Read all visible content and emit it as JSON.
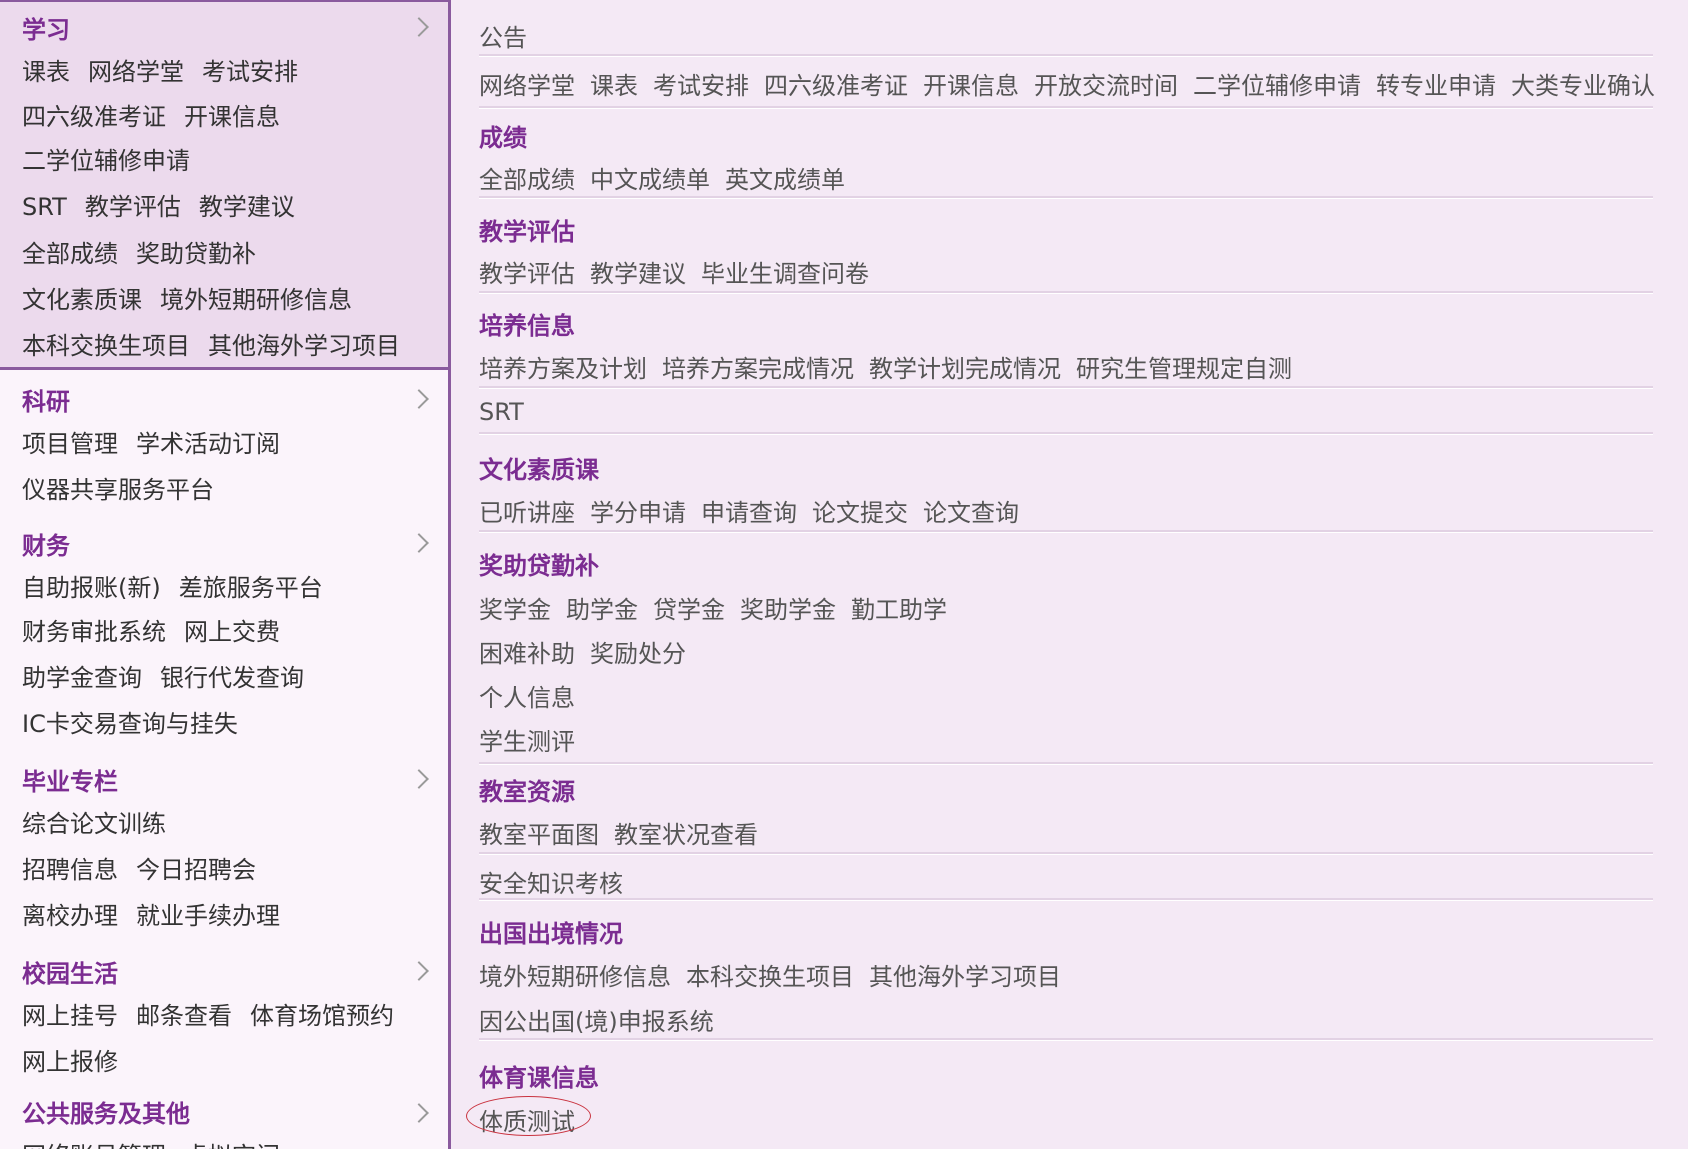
{
  "sidebar": {
    "sections": [
      {
        "title": "学习",
        "rows": [
          [
            "课表",
            "网络学堂",
            "考试安排"
          ],
          [
            "四六级准考证",
            "开课信息"
          ],
          [
            "二学位辅修申请"
          ],
          [
            "SRT",
            "教学评估",
            "教学建议"
          ],
          [
            "全部成绩",
            "奖助贷勤补"
          ],
          [
            "文化素质课",
            "境外短期研修信息"
          ],
          [
            "本科交换生项目",
            "其他海外学习项目"
          ]
        ]
      },
      {
        "title": "科研",
        "rows": [
          [
            "项目管理",
            "学术活动订阅"
          ],
          [
            "仪器共享服务平台"
          ]
        ]
      },
      {
        "title": "财务",
        "rows": [
          [
            "自助报账(新)",
            "差旅服务平台"
          ],
          [
            "财务审批系统",
            "网上交费"
          ],
          [
            "助学金查询",
            "银行代发查询"
          ],
          [
            "IC卡交易查询与挂失"
          ]
        ]
      },
      {
        "title": "毕业专栏",
        "rows": [
          [
            "综合论文训练"
          ],
          [
            "招聘信息",
            "今日招聘会"
          ],
          [
            "离校办理",
            "就业手续办理"
          ]
        ]
      },
      {
        "title": "校园生活",
        "rows": [
          [
            "网上挂号",
            "邮条查看",
            "体育场馆预约"
          ],
          [
            "网上报修"
          ]
        ]
      },
      {
        "title": "公共服务及其他",
        "rows": [
          [
            "网络账号管理",
            "虚拟空间"
          ]
        ]
      }
    ]
  },
  "content": {
    "groups": [
      {
        "title": "",
        "rows": [
          [
            "公告"
          ],
          [
            "网络学堂",
            "课表",
            "考试安排",
            "四六级准考证",
            "开课信息",
            "开放交流时间",
            "二学位辅修申请",
            "转专业申请",
            "大类专业确认"
          ]
        ]
      },
      {
        "title": "成绩",
        "rows": [
          [
            "全部成绩",
            "中文成绩单",
            "英文成绩单"
          ]
        ]
      },
      {
        "title": "教学评估",
        "rows": [
          [
            "教学评估",
            "教学建议",
            "毕业生调查问卷"
          ]
        ]
      },
      {
        "title": "培养信息",
        "rows": [
          [
            "培养方案及计划",
            "培养方案完成情况",
            "教学计划完成情况",
            "研究生管理规定自测"
          ]
        ]
      },
      {
        "title": "",
        "rows": [
          [
            "SRT"
          ]
        ]
      },
      {
        "title": "文化素质课",
        "rows": [
          [
            "已听讲座",
            "学分申请",
            "申请查询",
            "论文提交",
            "论文查询"
          ]
        ]
      },
      {
        "title": "奖助贷勤补",
        "rows": [
          [
            "奖学金",
            "助学金",
            "贷学金",
            "奖助学金",
            "勤工助学"
          ],
          [
            "困难补助",
            "奖励处分"
          ],
          [
            "个人信息"
          ],
          [
            "学生测评"
          ]
        ]
      },
      {
        "title": "教室资源",
        "rows": [
          [
            "教室平面图",
            "教室状况查看"
          ]
        ]
      },
      {
        "title": "",
        "rows": [
          [
            "安全知识考核"
          ]
        ]
      },
      {
        "title": "出国出境情况",
        "rows": [
          [
            "境外短期研修信息",
            "本科交换生项目",
            "其他海外学习项目"
          ],
          [
            "因公出国(境)申报系统"
          ]
        ]
      },
      {
        "title": "体育课信息",
        "rows": [
          [
            "体质测试"
          ]
        ]
      }
    ]
  },
  "colors": {
    "accent": "#7b2c91",
    "sidebar_bg": "#fbf4fb",
    "sidebar_active_bg": "#ecdaed",
    "content_bg": "#f4e9f5",
    "border": "#8a5a9e",
    "highlight_circle": "#c9333f"
  },
  "icons": {
    "section_expand": "chevron-right-icon"
  }
}
